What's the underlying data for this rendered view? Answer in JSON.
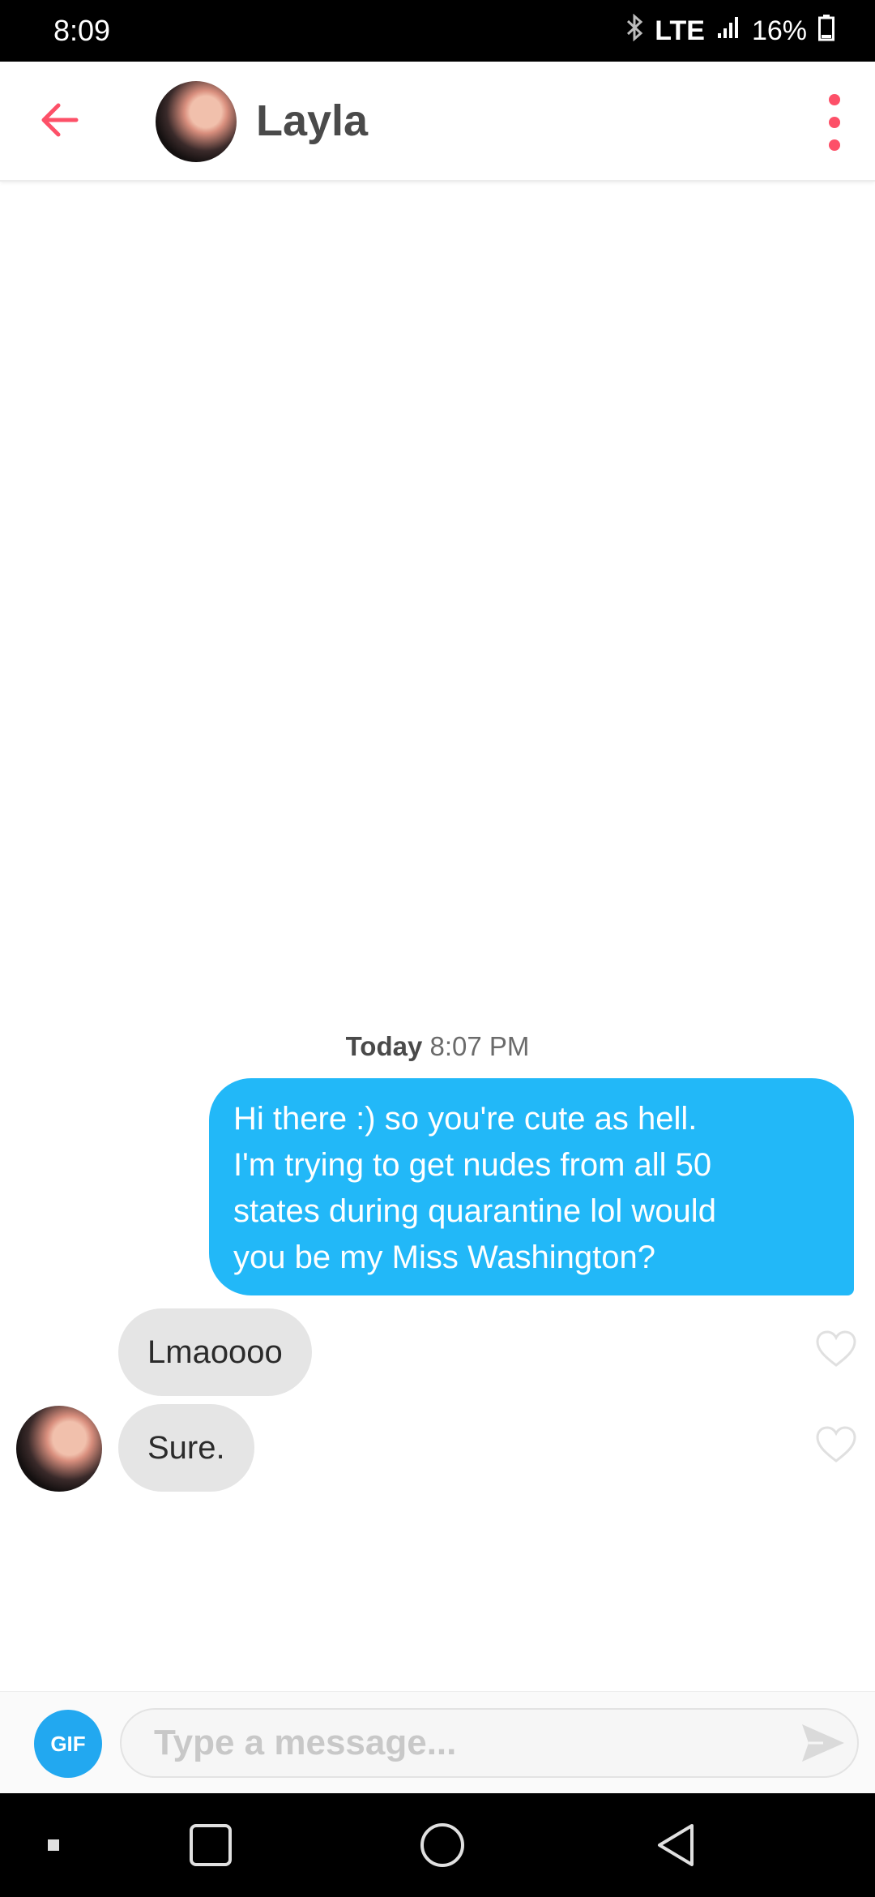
{
  "status_bar": {
    "time": "8:09",
    "network": "LTE",
    "battery_percent": "16%",
    "icons": [
      "bluetooth-icon",
      "signal-icon",
      "battery-icon"
    ]
  },
  "header": {
    "contact_name": "Layla",
    "icons": [
      "back-arrow-icon",
      "more-vertical-icon"
    ],
    "accent_color": "#fd5068"
  },
  "chat": {
    "timestamp_day": "Today",
    "timestamp_time": "8:07 PM",
    "messages": [
      {
        "direction": "outgoing",
        "lines": [
          "Hi there :) so you're cute as hell.",
          "I'm trying to get nudes from all 50",
          "states during quarantine lol would",
          "you be my Miss Washington?"
        ]
      },
      {
        "direction": "incoming",
        "text": "Lmaoooo",
        "liked": false
      },
      {
        "direction": "incoming",
        "text": "Sure.",
        "liked": false
      }
    ],
    "outgoing_color": "#22b8f8",
    "incoming_color": "#e5e5e5"
  },
  "composer": {
    "gif_label": "GIF",
    "placeholder": "Type a message...",
    "value": "",
    "icons": [
      "send-icon"
    ]
  },
  "nav_bar": {
    "icons": [
      "recent-apps-icon",
      "overview-icon",
      "home-icon",
      "back-icon"
    ]
  }
}
